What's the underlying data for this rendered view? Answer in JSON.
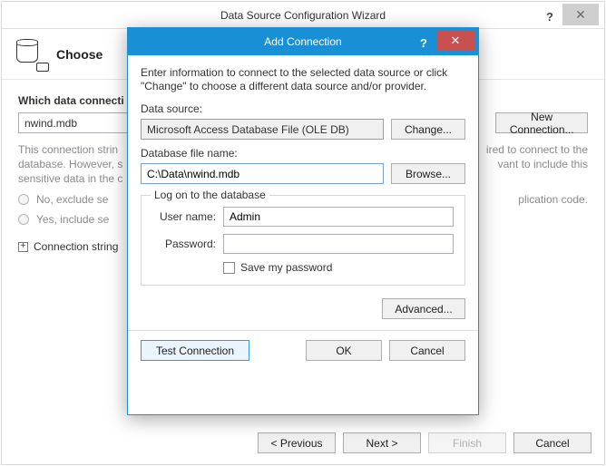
{
  "wizard": {
    "title": "Data Source Configuration Wizard",
    "choose_header": "Choose",
    "section_label": "Which data connecti",
    "connection_input_value": "nwind.mdb",
    "new_connection_label": "New Connection...",
    "hint_para1": "This connection strin",
    "hint_para1b": "ired to connect to the",
    "hint_para2": "database. However, s",
    "hint_para2b": "vant to include this",
    "hint_para3": "sensitive data in the c",
    "radio_no": "No, exclude se",
    "radio_no_suffix": "plication code.",
    "radio_yes": "Yes, include se",
    "expander_label": "Connection string",
    "footer": {
      "previous": "<  Previous",
      "next": "Next  >",
      "finish": "Finish",
      "cancel": "Cancel"
    }
  },
  "modal": {
    "title": "Add Connection",
    "intro": "Enter information to connect to the selected data source or click \"Change\" to choose a different data source and/or provider.",
    "data_source_label": "Data source:",
    "data_source_value": "Microsoft Access Database File (OLE DB)",
    "change_label": "Change...",
    "db_file_label": "Database file name:",
    "db_file_value": "C:\\Data\\nwind.mdb",
    "browse_label": "Browse...",
    "logon_legend": "Log on to the database",
    "username_label": "User name:",
    "username_value": "Admin",
    "password_label": "Password:",
    "password_value": "",
    "save_password_label": "Save my password",
    "advanced_label": "Advanced...",
    "test_label": "Test Connection",
    "ok_label": "OK",
    "cancel_label": "Cancel"
  }
}
